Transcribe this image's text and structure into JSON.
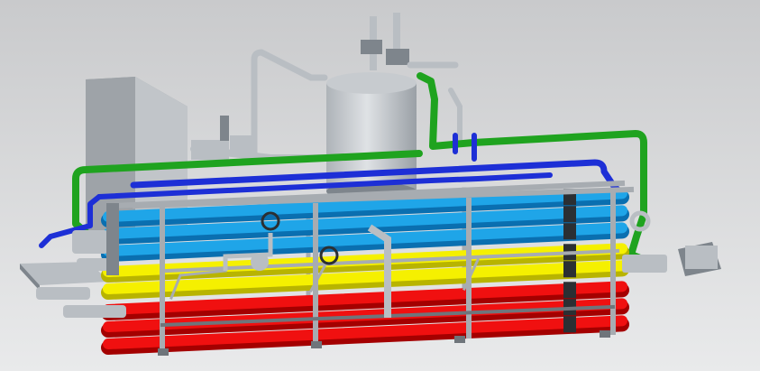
{
  "scene": {
    "kind": "3d-cad-render",
    "subject": "tubular-heat-exchanger-skid",
    "background": {
      "top": "#c9cacc",
      "bottom": "#e9eaeb"
    },
    "colors": {
      "frame": "#a7acb1",
      "frame_dark": "#6f757b",
      "steel": "#b9bec3",
      "steel_dark": "#7e858c",
      "cabinet": "#9ea3a8",
      "cabinet_light": "#c1c5c9",
      "tank": "#c7cbcf",
      "tube_light_blue": "#1fa5e8",
      "tube_blue_dark": "#0a6fb0",
      "tube_yellow": "#f5f000",
      "tube_yellow_dark": "#b8b400",
      "tube_red": "#f01010",
      "tube_red_dark": "#a40000",
      "pipe_green": "#1fa31f",
      "pipe_navy": "#1d2fd6",
      "valve_dark": "#2b2f33"
    },
    "tube_groups": [
      {
        "name": "light-blue",
        "rows": 3
      },
      {
        "name": "yellow",
        "rows": 2
      },
      {
        "name": "red",
        "rows": 3
      }
    ]
  }
}
